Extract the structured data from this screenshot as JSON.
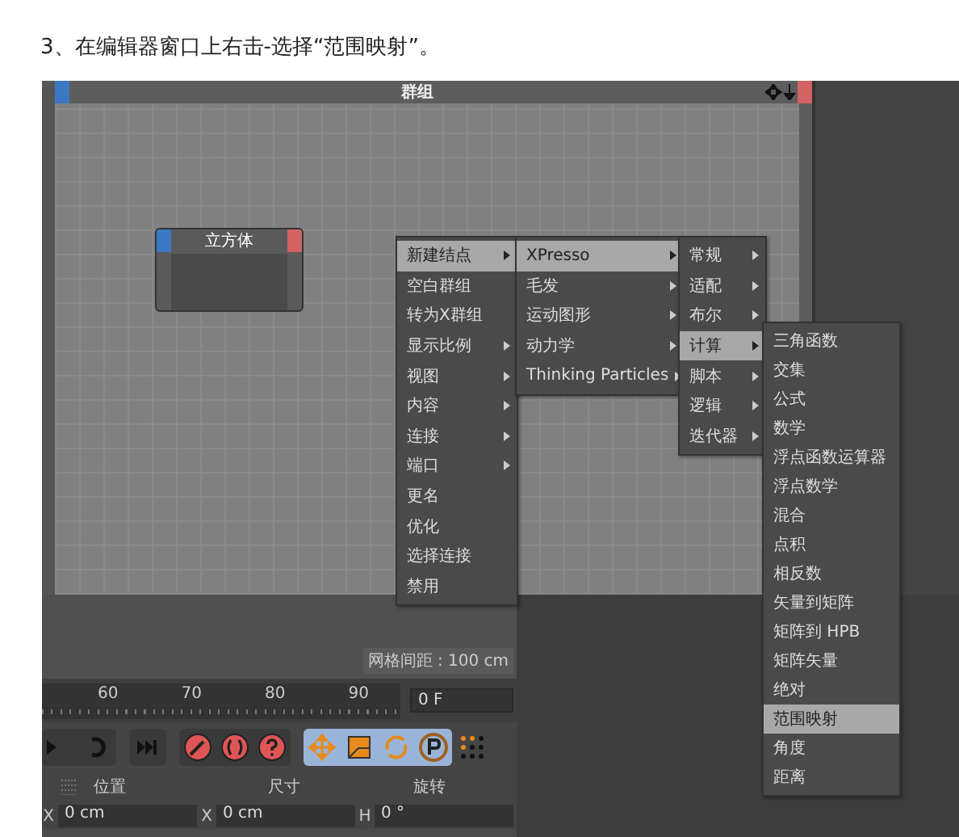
{
  "caption": "3、在编辑器窗口上右击-选择“范围映射”。",
  "editor": {
    "title": "群组",
    "node": {
      "title": "立方体"
    },
    "grid_spacing": "网格间距 : 100 cm"
  },
  "menus": [
    {
      "items": [
        {
          "label": "新建结点",
          "submenu": true,
          "selected": true
        },
        {
          "label": "空白群组",
          "submenu": false,
          "selected": false
        },
        {
          "label": "转为X群组",
          "submenu": false,
          "selected": false
        },
        {
          "label": "显示比例",
          "submenu": true,
          "selected": false
        },
        {
          "label": "视图",
          "submenu": true,
          "selected": false
        },
        {
          "label": "内容",
          "submenu": true,
          "selected": false
        },
        {
          "label": "连接",
          "submenu": true,
          "selected": false
        },
        {
          "label": "端口",
          "submenu": true,
          "selected": false
        },
        {
          "label": "更名",
          "submenu": false,
          "selected": false
        },
        {
          "label": "优化",
          "submenu": false,
          "selected": false
        },
        {
          "label": "选择连接",
          "submenu": false,
          "selected": false
        },
        {
          "label": "禁用",
          "submenu": false,
          "selected": false
        }
      ]
    },
    {
      "items": [
        {
          "label": "XPresso",
          "submenu": true,
          "selected": true
        },
        {
          "label": "毛发",
          "submenu": true,
          "selected": false
        },
        {
          "label": "运动图形",
          "submenu": true,
          "selected": false
        },
        {
          "label": "动力学",
          "submenu": true,
          "selected": false
        },
        {
          "label": "Thinking Particles",
          "submenu": true,
          "selected": false
        }
      ]
    },
    {
      "items": [
        {
          "label": "常规",
          "submenu": true,
          "selected": false
        },
        {
          "label": "适配",
          "submenu": true,
          "selected": false
        },
        {
          "label": "布尔",
          "submenu": true,
          "selected": false
        },
        {
          "label": "计算",
          "submenu": true,
          "selected": true
        },
        {
          "label": "脚本",
          "submenu": true,
          "selected": false
        },
        {
          "label": "逻辑",
          "submenu": true,
          "selected": false
        },
        {
          "label": "迭代器",
          "submenu": true,
          "selected": false
        }
      ]
    },
    {
      "items": [
        {
          "label": "三角函数",
          "submenu": false,
          "selected": false
        },
        {
          "label": "交集",
          "submenu": false,
          "selected": false
        },
        {
          "label": "公式",
          "submenu": false,
          "selected": false
        },
        {
          "label": "数学",
          "submenu": false,
          "selected": false
        },
        {
          "label": "浮点函数运算器",
          "submenu": false,
          "selected": false
        },
        {
          "label": "浮点数学",
          "submenu": false,
          "selected": false
        },
        {
          "label": "混合",
          "submenu": false,
          "selected": false
        },
        {
          "label": "点积",
          "submenu": false,
          "selected": false
        },
        {
          "label": "相反数",
          "submenu": false,
          "selected": false
        },
        {
          "label": "矢量到矩阵",
          "submenu": false,
          "selected": false
        },
        {
          "label": "矩阵到 HPB",
          "submenu": false,
          "selected": false
        },
        {
          "label": "矩阵矢量",
          "submenu": false,
          "selected": false
        },
        {
          "label": "绝对",
          "submenu": false,
          "selected": false
        },
        {
          "label": "范围映射",
          "submenu": false,
          "selected": true
        },
        {
          "label": "角度",
          "submenu": false,
          "selected": false
        },
        {
          "label": "距离",
          "submenu": false,
          "selected": false
        }
      ]
    }
  ],
  "timeline": {
    "ticks": [
      "60",
      "70",
      "80",
      "90"
    ],
    "frame_field": "0 F"
  },
  "coordinates": {
    "columns": [
      "位置",
      "尺寸",
      "旋转"
    ],
    "fields": [
      {
        "axis": "X",
        "value": "0 cm"
      },
      {
        "axis": "X",
        "value": "0 cm"
      },
      {
        "axis": "H",
        "value": "0 °"
      }
    ]
  }
}
